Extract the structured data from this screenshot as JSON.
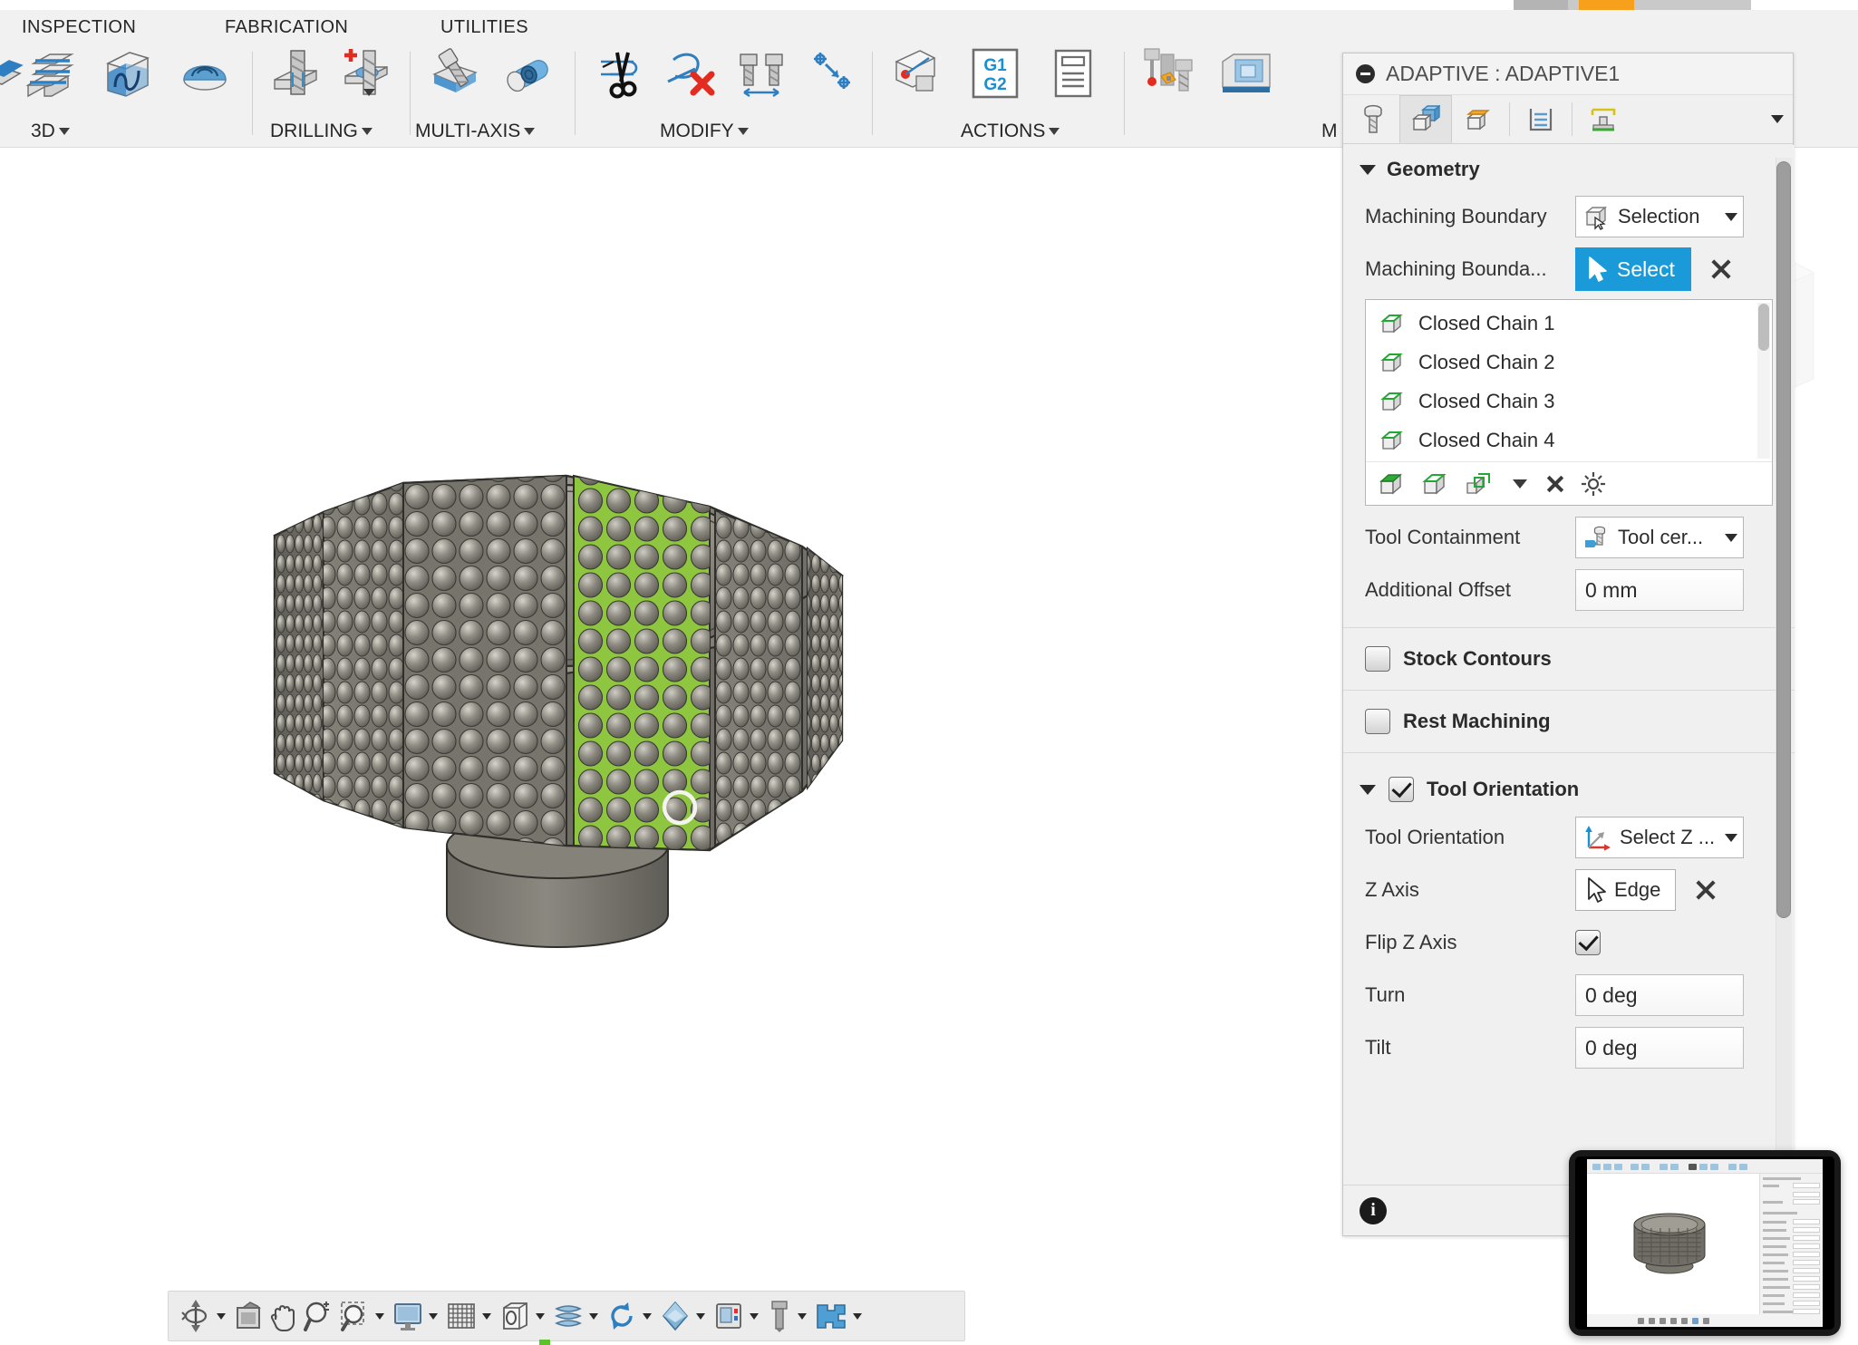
{
  "app": {
    "ribbon_groups": [
      "INSPECTION",
      "FABRICATION",
      "UTILITIES"
    ],
    "group_labels": [
      "3D",
      "DRILLING",
      "MULTI-AXIS",
      "MODIFY",
      "ACTIONS",
      "M"
    ],
    "buttons": {
      "parallel": "parallel-3d",
      "scallop": "scallop-3d",
      "morphed_spiral": "morphed-spiral-3d",
      "drill": "drill",
      "bore": "bore-add",
      "swarf": "swarf-multi-axis",
      "rotary": "rotary-multi-axis",
      "trim": "trim-toolpath",
      "delete": "delete-toolpath",
      "tool_change": "tool-change",
      "transform": "transform",
      "probe": "probe-wcs",
      "g1g2": "G1 G2",
      "setup_sheet": "setup-sheet",
      "simulate": "simulate",
      "machine": "machine-simulation"
    }
  },
  "dialog": {
    "title": "ADAPTIVE : ADAPTIVE1",
    "tabs": [
      {
        "name": "tool-tab",
        "icon": "endmill-icon",
        "active": false
      },
      {
        "name": "geometry-tab",
        "icon": "geometry-cube-icon",
        "active": true
      },
      {
        "name": "heights-tab",
        "icon": "heights-icon",
        "active": false
      },
      {
        "name": "passes-tab",
        "icon": "passes-icon",
        "active": false
      },
      {
        "name": "linking-tab",
        "icon": "linking-icon",
        "active": false
      }
    ],
    "geometry": {
      "section_label": "Geometry",
      "machining_boundary_label": "Machining Boundary",
      "machining_boundary_value": "Selection",
      "machining_boundary_sel_label": "Machining Bounda...",
      "select_button_label": "Select",
      "chains": [
        "Closed Chain 1",
        "Closed Chain 2",
        "Closed Chain 3",
        "Closed Chain 4"
      ],
      "tool_containment_label": "Tool Containment",
      "tool_containment_value": "Tool cer...",
      "additional_offset_label": "Additional Offset",
      "additional_offset_value": "0 mm"
    },
    "stock_contours": {
      "label": "Stock Contours",
      "checked": false
    },
    "rest_machining": {
      "label": "Rest Machining",
      "checked": false
    },
    "tool_orientation": {
      "section_label": "Tool Orientation",
      "section_checked": true,
      "orientation_label": "Tool Orientation",
      "orientation_value": "Select Z ...",
      "z_axis_label": "Z Axis",
      "z_axis_value": "Edge",
      "flip_z_label": "Flip Z Axis",
      "flip_z_checked": true,
      "turn_label": "Turn",
      "turn_value": "0 deg",
      "tilt_label": "Tilt",
      "tilt_value": "0 deg"
    },
    "footer": {
      "info_icon": "info-icon",
      "ok_label": ""
    }
  },
  "navbar": {
    "items": [
      {
        "name": "orbit-icon",
        "caret": true
      },
      {
        "name": "look-at-icon",
        "caret": false
      },
      {
        "name": "pan-icon",
        "caret": false
      },
      {
        "name": "zoom-icon",
        "caret": false
      },
      {
        "name": "zoom-window-icon",
        "caret": true
      },
      {
        "name": "display-settings-icon",
        "caret": true
      },
      {
        "name": "grid-snaps-icon",
        "caret": true
      },
      {
        "name": "viewports-icon",
        "caret": true
      },
      {
        "name": "stock-visibility-icon",
        "caret": true
      },
      {
        "name": "refresh-icon",
        "caret": true
      },
      {
        "name": "appearance-icon",
        "caret": true
      },
      {
        "name": "machine-icon",
        "caret": true
      },
      {
        "name": "tool-library-icon",
        "caret": true
      },
      {
        "name": "simulation-icon",
        "caret": true
      }
    ]
  },
  "canvas": {
    "model_name": "knurled-knob-part",
    "selected_face_color": "#8ec63f",
    "body_color": "#7d7a73"
  },
  "player": {
    "progress_color": "#f7a01b"
  }
}
